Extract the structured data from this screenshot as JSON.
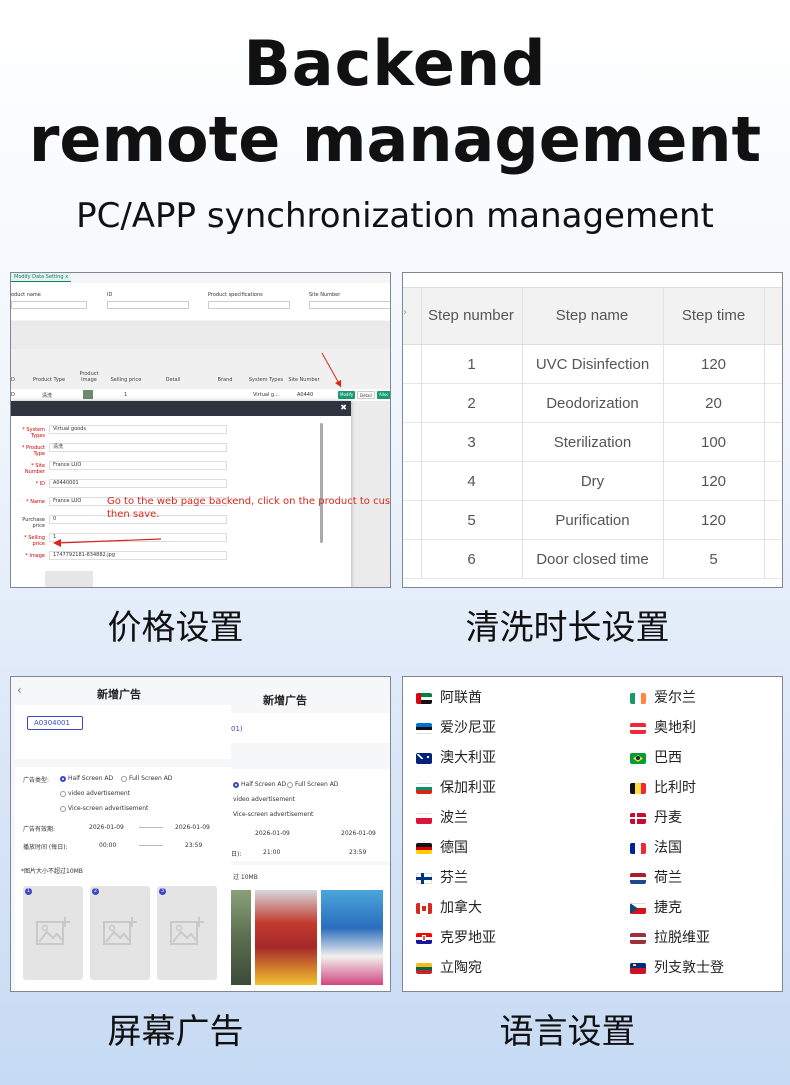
{
  "header": {
    "line1": "Backend",
    "line2": "remote management",
    "subtitle": "PC/APP synchronization management"
  },
  "captions": {
    "price": "价格设置",
    "wash": "清洗时长设置",
    "ads": "屏幕广告",
    "language": "语言设置"
  },
  "price_panel": {
    "tab": "Modify Data Setting",
    "filters": [
      "oduct name",
      "ID",
      "Product specifications",
      "Site Number"
    ],
    "columns": [
      "Product Type",
      "Product Image",
      "Selling price",
      "Detail",
      "Brand",
      "System Types",
      "Site Number"
    ],
    "row": {
      "id": "D",
      "type": "清洗",
      "price": "1",
      "system": "Virtual g...",
      "site": "A0440"
    },
    "buttons": {
      "modify": "Modify",
      "detail": "Detail",
      "allocate": "Alloc"
    },
    "fields": [
      {
        "label": "System Types",
        "value": "Virtual goods",
        "required": true
      },
      {
        "label": "Product Type",
        "value": "清洗",
        "required": true
      },
      {
        "label": "Site Number",
        "value": "France LUO",
        "required": true
      },
      {
        "label": "ID",
        "value": "A0440001",
        "required": true
      },
      {
        "label": "Name",
        "value": "France LUO",
        "required": true
      },
      {
        "label": "Purchase price",
        "value": "0",
        "required": false
      },
      {
        "label": "Selling price",
        "value": "1",
        "required": true
      },
      {
        "label": "Image",
        "value": "1747792181-834882.jpg",
        "required": true
      }
    ],
    "note": "Go to the web page backend, click on the product to custo then save."
  },
  "steps_panel": {
    "columns": [
      "Step number",
      "Step name",
      "Step time"
    ],
    "rows": [
      {
        "number": "1",
        "name": "UVC Disinfection",
        "time": "120"
      },
      {
        "number": "2",
        "name": "Deodorization",
        "time": "20"
      },
      {
        "number": "3",
        "name": "Sterilization",
        "time": "100"
      },
      {
        "number": "4",
        "name": "Dry",
        "time": "120"
      },
      {
        "number": "5",
        "name": "Purification",
        "time": "120"
      },
      {
        "number": "6",
        "name": "Door closed time",
        "time": "5"
      }
    ]
  },
  "ads_panel": {
    "title": "新增广告",
    "back_icon": "chevron-left-icon",
    "site_chip": "A0304001",
    "type_label": "广告类型:",
    "options": [
      "Half Screen AD",
      "Full Screen AD",
      "video advertisement",
      "Vice-screen advertisement"
    ],
    "valid_label": "广告有效期:",
    "valid_start": "2026-01-09",
    "valid_end": "2026-01-09",
    "play_label": "播放时间 (每日):",
    "play_start": "00:00",
    "play_end": "23:59",
    "play_start_2": "21:00",
    "size_note": "*图片大小不超过10MB",
    "size_note_partial": "过 10MB",
    "play_label_partial": "日):",
    "slot_numbers": [
      "1",
      "2",
      "3"
    ]
  },
  "language_panel": {
    "left": [
      {
        "name": "阿联酋",
        "flag": "uae"
      },
      {
        "name": "爱沙尼亚",
        "flag": "estonia"
      },
      {
        "name": "澳大利亚",
        "flag": "australia"
      },
      {
        "name": "保加利亚",
        "flag": "bulgaria"
      },
      {
        "name": "波兰",
        "flag": "poland"
      },
      {
        "name": "德国",
        "flag": "germany"
      },
      {
        "name": "芬兰",
        "flag": "finland"
      },
      {
        "name": "加拿大",
        "flag": "canada"
      },
      {
        "name": "克罗地亚",
        "flag": "croatia"
      },
      {
        "name": "立陶宛",
        "flag": "lithuania"
      }
    ],
    "right": [
      {
        "name": "爱尔兰",
        "flag": "ireland"
      },
      {
        "name": "奥地利",
        "flag": "austria"
      },
      {
        "name": "巴西",
        "flag": "brazil"
      },
      {
        "name": "比利时",
        "flag": "belgium"
      },
      {
        "name": "丹麦",
        "flag": "denmark"
      },
      {
        "name": "法国",
        "flag": "france"
      },
      {
        "name": "荷兰",
        "flag": "netherlands"
      },
      {
        "name": "捷克",
        "flag": "czech"
      },
      {
        "name": "拉脱维亚",
        "flag": "latvia"
      },
      {
        "name": "列支敦士登",
        "flag": "liechtenstein"
      }
    ]
  },
  "colors": {
    "accent_green": "#1a7f64",
    "note_red": "#d8261c",
    "ad_blue": "#3b46c9"
  }
}
